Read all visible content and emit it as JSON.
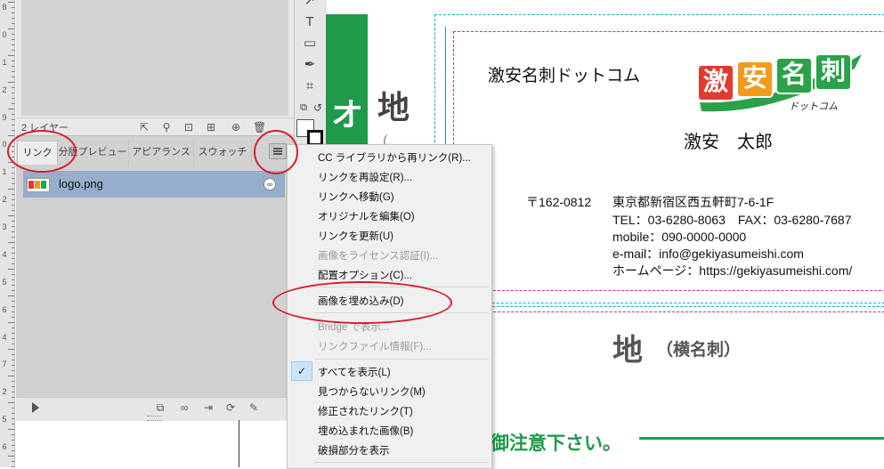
{
  "ruler": {
    "numbers": [
      "8",
      "0",
      "1",
      "2",
      "9",
      "0",
      "1",
      "2",
      "3",
      "4",
      "5",
      "6",
      "4",
      "7",
      "2",
      "5",
      "6"
    ]
  },
  "layers_panel": {
    "count_label": "2 レイヤー"
  },
  "links_panel": {
    "tabs": [
      "リンク",
      "分版プレビュー",
      "アピアランス",
      "スウォッチ"
    ],
    "active_tab": "リンク",
    "items": [
      {
        "name": "logo.png"
      }
    ]
  },
  "context_menu": {
    "items": [
      {
        "label": "CC ライブラリから再リンク(R)...",
        "enabled": true
      },
      {
        "label": "リンクを再設定(R)...",
        "enabled": true
      },
      {
        "label": "リンクへ移動(G)",
        "enabled": true
      },
      {
        "label": "オリジナルを編集(O)",
        "enabled": true
      },
      {
        "label": "リンクを更新(U)",
        "enabled": true
      },
      {
        "label": "画像をライセンス認証(I)...",
        "enabled": false
      },
      {
        "label": "配置オプション(C)...",
        "enabled": true
      },
      {
        "label": "画像を埋め込み(D)",
        "enabled": true
      },
      {
        "label": "Bridge で表示...",
        "enabled": false
      },
      {
        "label": "リンクファイル情報(F)...",
        "enabled": false
      },
      {
        "label": "すべてを表示(L)",
        "enabled": true,
        "checked": true
      },
      {
        "label": "見つからないリンク(M)",
        "enabled": true
      },
      {
        "label": "修正されたリンク(T)",
        "enabled": true
      },
      {
        "label": "埋め込まれた画像(B)",
        "enabled": true
      },
      {
        "label": "破損部分を表示",
        "enabled": true
      }
    ]
  },
  "document": {
    "green_bar_char": "オ",
    "side_heading": "地",
    "card": {
      "company": "激安名刺ドットコム",
      "logo_text": "激安名刺",
      "logo_sub": "ドットコム",
      "person": "激安　太郎",
      "postal": "〒162-0812",
      "address": "東京都新宿区西五軒町7-6-1F",
      "tel_fax": "TEL：03-6280-8063　FAX：03-6280-7687",
      "mobile": "mobile：090-0000-0000",
      "email": "e-mail：info@gekiyasumeishi.com",
      "homepage": "ホームページ：https://gekiyasumeishi.com/"
    },
    "heading": "地",
    "heading_sub": "（横名刺）",
    "notice": "御注意下さい。"
  },
  "colors": {
    "accent_green": "#1f9a4a",
    "highlight_red": "#d81c2c",
    "selection_blue": "#96aecb"
  }
}
